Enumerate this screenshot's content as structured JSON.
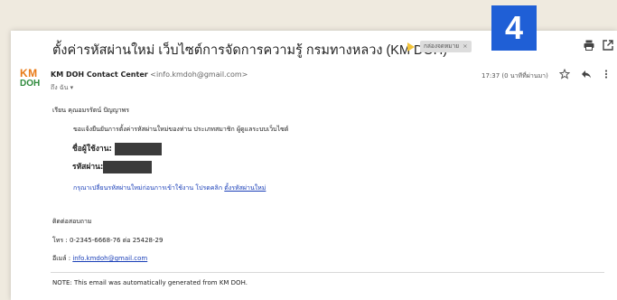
{
  "badge": "4",
  "subject": "ตั้งค่ารหัสผ่านใหม่ เว็บไซต์การจัดการความรู้ กรมทางหลวง (KM DOH)",
  "label_chip": "กล่องจดหมาย",
  "label_chip_close": "×",
  "logo": {
    "line1": "KM",
    "line2": "DOH"
  },
  "sender": {
    "name": "KM DOH Contact Center",
    "email": "<info.kmdoh@gmail.com>",
    "to": "ถึง ฉัน ▾"
  },
  "time": "17:37 (0 นาทีที่ผ่านมา)",
  "body": {
    "greeting": "เรียน คุณอมรรัตน์ ปัญญาพร",
    "intro": "ขอแจ้งยืนยันการตั้งค่ารหัสผ่านใหม่ของท่าน ประเภทสมาชิก ผู้ดูแลระบบเว็บไซต์",
    "username_label": "ชื่อผู้ใช้งาน:",
    "password_label": "รหัสผ่าน:",
    "change_prompt": "กรุณาเปลี่ยนรหัสผ่านใหม่ก่อนการเข้าใช้งาน โปรดคลิก",
    "change_link": "ตั้งรหัสผ่านใหม่",
    "contact_heading": "ติดต่อสอบถาม",
    "phone": "โทร : 0-2345-6668-76 ต่อ 25428-29",
    "email_label": "อีเมล์ :",
    "email_value": "info.kmdoh@gmail.com",
    "note": "NOTE: This email was automatically generated from KM DOH."
  },
  "icons": {
    "print": "print-icon",
    "open_new": "open-in-new-window-icon",
    "star": "star-icon",
    "reply": "reply-icon",
    "more": "more-vertical-icon"
  }
}
